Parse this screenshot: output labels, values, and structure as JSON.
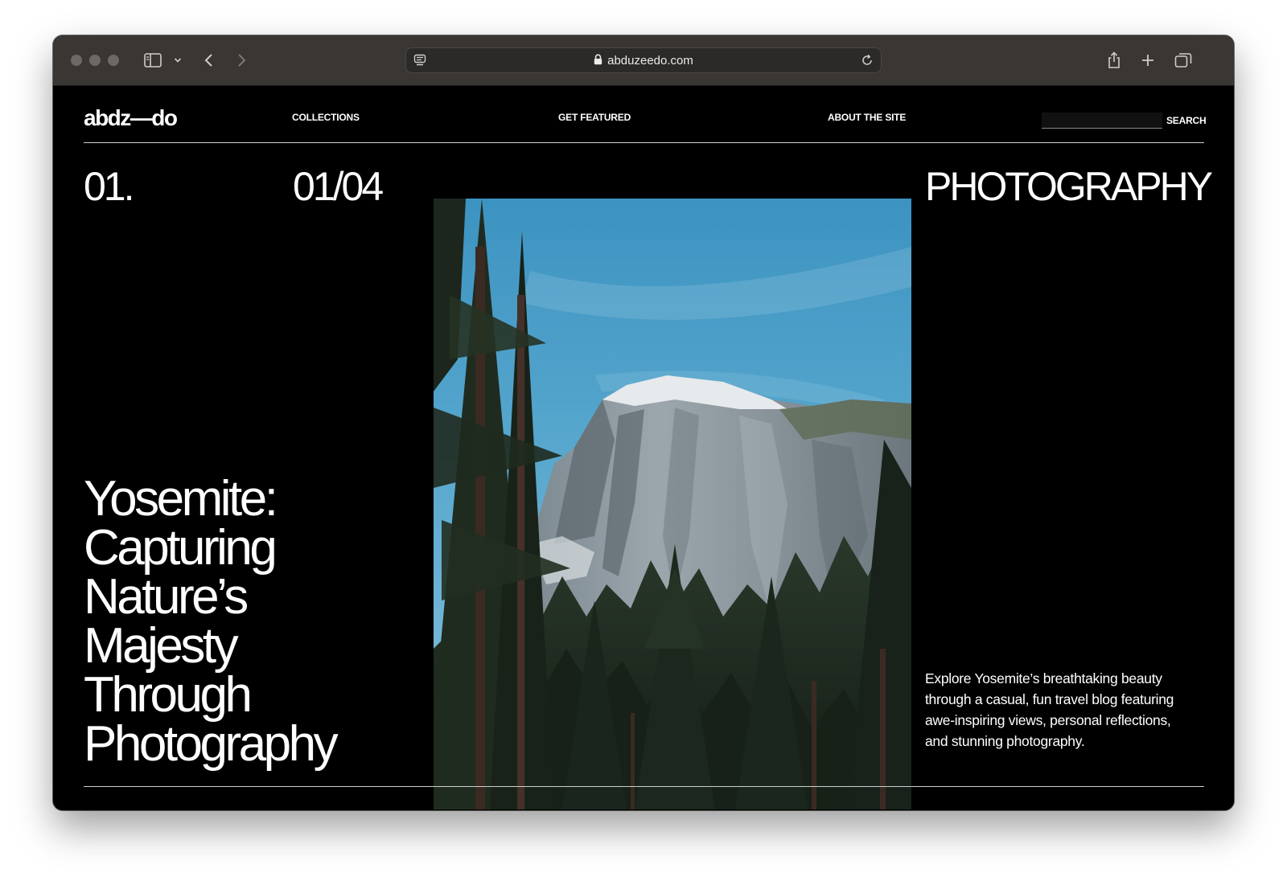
{
  "browser": {
    "url": "abduzeedo.com"
  },
  "site": {
    "logo": "abdz—do",
    "nav": [
      {
        "label": "COLLECTIONS"
      },
      {
        "label": "GET FEATURED"
      },
      {
        "label": "ABOUT THE SITE"
      }
    ],
    "search": {
      "value": "",
      "button_label": "SEARCH"
    }
  },
  "hero": {
    "index": "01.",
    "counter": "01/04",
    "category": "PHOTOGRAPHY",
    "headline_lines": [
      "Yosemite:",
      "Capturing",
      "Nature’s",
      "Majesty",
      "Through",
      "Photography"
    ],
    "description": "Explore Yosemite’s breathtaking beauty through a casual, fun travel blog featuring awe-inspiring views, personal reflections, and stunning photography."
  },
  "colors": {
    "page_background": "#000000",
    "toolbar_background": "#3a3634",
    "sky": "#3f97c2",
    "forest": "#1e2a1f"
  }
}
